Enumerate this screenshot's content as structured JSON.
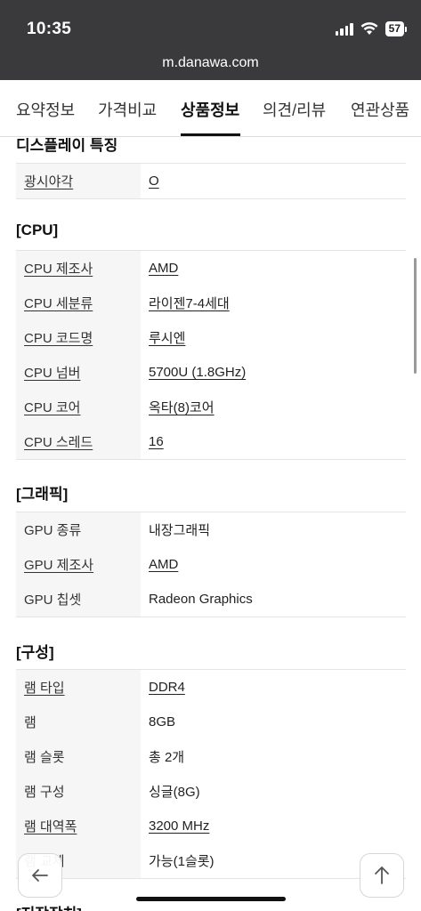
{
  "status_bar": {
    "time": "10:35",
    "battery": "57"
  },
  "browser": {
    "url": "m.danawa.com"
  },
  "tabs": [
    "요약정보",
    "가격비교",
    "상품정보",
    "의견/리뷰",
    "연관상품"
  ],
  "active_tab": "상품정보",
  "sections": {
    "display": {
      "title": "디스플레이 특징",
      "rows": [
        {
          "label": "광시야각",
          "value": "O"
        }
      ]
    },
    "cpu": {
      "title": "[CPU]",
      "rows": [
        {
          "label": "CPU 제조사",
          "value": "AMD"
        },
        {
          "label": "CPU 세분류",
          "value": "라이젠7-4세대"
        },
        {
          "label": "CPU 코드명",
          "value": "루시엔"
        },
        {
          "label": "CPU 넘버",
          "value": "5700U (1.8GHz)"
        },
        {
          "label": "CPU 코어",
          "value": "옥타(8)코어"
        },
        {
          "label": "CPU 스레드",
          "value": "16"
        }
      ]
    },
    "graphics": {
      "title": "[그래픽]",
      "rows": [
        {
          "label": "GPU 종류",
          "value": "내장그래픽"
        },
        {
          "label": "GPU 제조사",
          "value": "AMD"
        },
        {
          "label": "GPU 칩셋",
          "value": "Radeon Graphics"
        }
      ]
    },
    "config": {
      "title": "[구성]",
      "rows": [
        {
          "label": "램 타입",
          "value": "DDR4"
        },
        {
          "label": "램",
          "value": "8GB"
        },
        {
          "label": "램 슬롯",
          "value": "총 2개"
        },
        {
          "label": "램 구성",
          "value": "싱글(8G)"
        },
        {
          "label": "램 대역폭",
          "value": "3200 MHz"
        },
        {
          "label": "램 교체",
          "value": "가능(1슬롯)"
        }
      ]
    },
    "storage": {
      "title": "[저장장치]"
    }
  },
  "icons": {
    "back": "arrow-left-icon",
    "top": "arrow-up-icon"
  }
}
